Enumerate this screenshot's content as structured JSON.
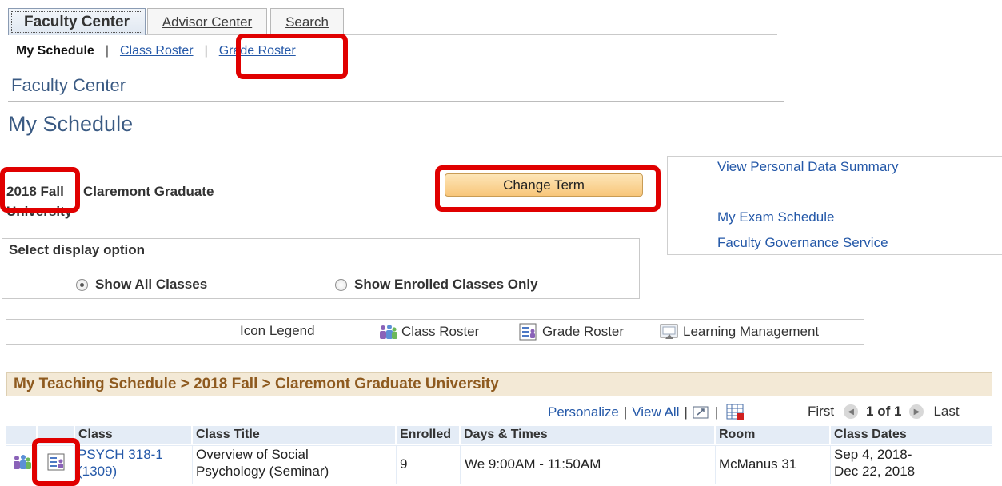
{
  "tabs": [
    {
      "label": "Faculty Center",
      "active": true
    },
    {
      "label": "Advisor Center",
      "active": false
    },
    {
      "label": "Search",
      "active": false
    }
  ],
  "subnav": {
    "current": "My Schedule",
    "separator": "|",
    "class_roster": "Class Roster",
    "grade_roster": "Grade Roster"
  },
  "page_header": "Faculty Center",
  "page_title": "My Schedule",
  "term": {
    "name": "2018 Fall",
    "institution_line1": "Claremont Graduate",
    "institution_line2": "University",
    "change_term_label": "Change Term"
  },
  "side_links": [
    "View Personal Data Summary",
    "My Exam Schedule",
    "Faculty Governance Service"
  ],
  "display_option": {
    "label": "Select display option",
    "options": [
      {
        "label": "Show All Classes",
        "selected": true
      },
      {
        "label": "Show Enrolled Classes Only",
        "selected": false
      }
    ]
  },
  "legend": {
    "title": "Icon Legend",
    "items": [
      {
        "icon": "class-roster-icon",
        "label": "Class Roster"
      },
      {
        "icon": "grade-roster-icon",
        "label": "Grade Roster"
      },
      {
        "icon": "learning-management-icon",
        "label": "Learning Management"
      }
    ]
  },
  "schedule": {
    "title": "My Teaching Schedule > 2018 Fall > Claremont Graduate University",
    "personalize": "Personalize",
    "view_all": "View All",
    "separator": "|",
    "first": "First",
    "pager": "1 of 1",
    "last": "Last",
    "columns": [
      "Class",
      "Class Title",
      "Enrolled",
      "Days & Times",
      "Room",
      "Class Dates"
    ],
    "rows": [
      {
        "class_line1": "PSYCH 318-1",
        "class_line2": "(1309)",
        "title_line1": "Overview of Social",
        "title_line2": "Psychology (Seminar)",
        "enrolled": "9",
        "days_times": "We 9:00AM - 11:50AM",
        "room": "McManus 31",
        "dates_line1": "Sep 4, 2018-",
        "dates_line2": "Dec 22, 2018"
      }
    ]
  },
  "colors": {
    "link": "#2458a8",
    "header_blue": "#3a5a83",
    "grid_title_bg": "#f3e9d6",
    "grid_title_text": "#8e5a1f",
    "column_header_bg": "#e4ecf6",
    "button_gold": "#f8c67a",
    "annotation_red": "#e00000"
  }
}
